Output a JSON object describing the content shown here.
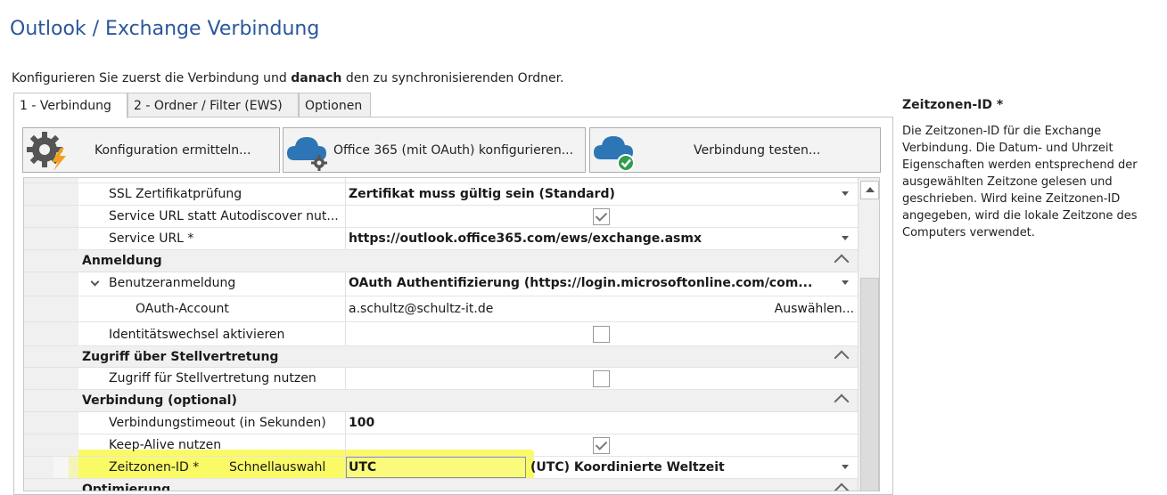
{
  "header": {
    "title": "Outlook / Exchange Verbindung",
    "intro_pre": "Konfigurieren Sie zuerst die Verbindung und ",
    "intro_bold": "danach",
    "intro_post": " den zu synchronisierenden Ordner."
  },
  "tabs": [
    {
      "label": "1 - Verbindung",
      "active": true
    },
    {
      "label": "2 - Ordner / Filter (EWS)",
      "active": false
    },
    {
      "label": "Optionen",
      "active": false
    }
  ],
  "toolbar": {
    "detect_label": "Konfiguration ermitteln...",
    "o365_label": "Office 365 (mit OAuth) konfigurieren...",
    "test_label": "Verbindung testen..."
  },
  "grid": {
    "ssl_name": "SSL Zertifikatprüfung",
    "ssl_value": "Zertifikat muss gültig sein (Standard)",
    "serviceurl_instead_name": "Service URL statt Autodiscover nut...",
    "serviceurl_instead_checked": true,
    "serviceurl_name": "Service URL *",
    "serviceurl_value": "https://outlook.office365.com/ews/exchange.asmx",
    "cat_login": "Anmeldung",
    "userlogin_name": "Benutzeranmeldung",
    "userlogin_value": "OAuth Authentifizierung (https://login.microsoftonline.com/com...",
    "oauth_name": "OAuth-Account",
    "oauth_value": "a.schultz@schultz-it.de",
    "oauth_choose": "Auswählen...",
    "identity_name": "Identitätswechsel aktivieren",
    "identity_checked": false,
    "cat_delegate": "Zugriff über Stellvertretung",
    "delegate_name": "Zugriff für Stellvertretung nutzen",
    "delegate_checked": false,
    "cat_connection": "Verbindung (optional)",
    "timeout_name": "Verbindungstimeout (in Sekunden)",
    "timeout_value": "100",
    "keepalive_name": "Keep-Alive nutzen",
    "keepalive_checked": true,
    "tz_name": "Zeitzonen-ID *",
    "tz_quick": "Schnellauswahl",
    "tz_value": "UTC",
    "tz_display": "(UTC) Koordinierte Weltzeit",
    "cat_optimize": "Optimierung"
  },
  "help": {
    "title": "Zeitzonen-ID *",
    "text": "Die Zeitzonen-ID für die Exchange Verbindung. Die Datum- und Uhrzeit Eigenschaften werden entsprechend der ausgewählten Zeitzone gelesen und geschrieben. Wird keine Zeitzonen-ID angegeben, wird die lokale Zeitzone des Computers verwendet."
  },
  "colors": {
    "title": "#2b579a",
    "highlight": "#f8f83c",
    "cloud": "#2e75b6",
    "check": "#2e9e4f",
    "gear": "#555555",
    "bolt": "#f0a020"
  },
  "icons": [
    "gear-lightning-icon",
    "cloud-gear-icon",
    "cloud-check-icon"
  ]
}
